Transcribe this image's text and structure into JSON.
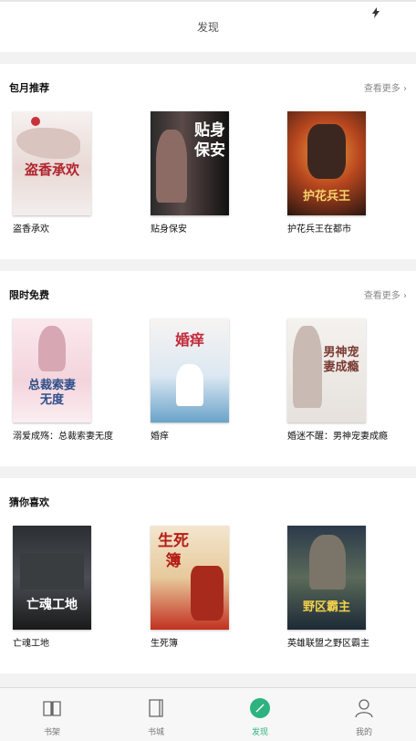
{
  "header": {
    "title": "发现"
  },
  "sections": [
    {
      "title": "包月推荐",
      "more": "查看更多",
      "books": [
        {
          "name": "盗香承欢",
          "cover_text": "盗香承欢"
        },
        {
          "name": "贴身保安",
          "cover_text": "贴身保安"
        },
        {
          "name": "护花兵王在都市",
          "cover_text": "护花兵王"
        }
      ]
    },
    {
      "title": "限时免费",
      "more": "查看更多",
      "books": [
        {
          "name": "溺爱成殇：总裁索妻无度",
          "cover_text": "总裁索妻无度"
        },
        {
          "name": "婚痒",
          "cover_text": "婚痒"
        },
        {
          "name": "婚迷不醒：男神宠妻成瘾",
          "cover_text": "男神宠妻成瘾"
        }
      ]
    },
    {
      "title": "猜你喜欢",
      "books": [
        {
          "name": "亡魂工地",
          "cover_text": "亡魂工地"
        },
        {
          "name": "生死簿",
          "cover_text": "生死簿"
        },
        {
          "name": "英雄联盟之野区霸主",
          "cover_text": "野区霸主"
        }
      ]
    }
  ],
  "tabs": [
    {
      "label": "书架",
      "icon": "bookshelf-icon"
    },
    {
      "label": "书城",
      "icon": "bookstore-icon"
    },
    {
      "label": "发现",
      "icon": "discover-icon"
    },
    {
      "label": "我的",
      "icon": "profile-icon"
    }
  ],
  "colors": {
    "accent": "#2db37f",
    "background": "#f2f2f2"
  }
}
